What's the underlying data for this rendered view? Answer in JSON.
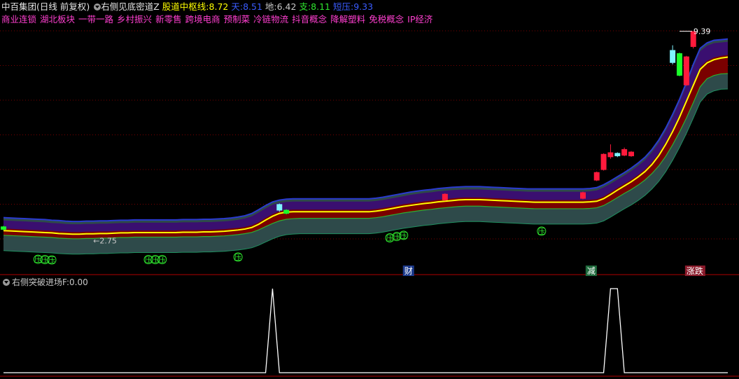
{
  "header": {
    "stock": "中百集团",
    "period": "(日线 前复权)",
    "indicator": "右侧见底密道Z",
    "pivot_label": "股道中枢线:",
    "pivot_value": "8.72",
    "sky_label": "天:",
    "sky_value": "8.51",
    "earth_label": "地:",
    "earth_value": "6.42",
    "support_label": "支:",
    "support_value": "8.11",
    "resist_label": "短压:",
    "resist_value": "9.33"
  },
  "concepts": [
    "商业连锁",
    "湖北板块",
    "一带一路",
    "乡村振兴",
    "新零售",
    "跨境电商",
    "预制菜",
    "冷链物流",
    "抖音概念",
    "降解塑料",
    "免税概念",
    "IP经济"
  ],
  "sub_indicator": {
    "name": "右侧突破进场F",
    "separator": ":",
    "value": "0.00"
  },
  "annotations": {
    "high": "9.39",
    "low": "2.75",
    "pressure": "压",
    "event_cai": "财",
    "event_jian": "减",
    "event_zhangdie": "涨跌"
  },
  "colors": {
    "band_outer": "#2e4a4a",
    "band_red": "#7a0000",
    "band_purple": "#3a0f70",
    "upper_line": "#2a3ad0",
    "middle_line": "#ffff00",
    "lower_line": "#2fae2f",
    "candle_up": "#ff1a3c",
    "candle_down": "#1aff2a",
    "candle_cyan": "#7ff4ff",
    "pressure_green": "#2ee62e",
    "signal_line": "#ffffff",
    "grid": "#7a0000"
  },
  "chart_data": {
    "type": "line",
    "x": [
      0,
      1,
      2,
      3,
      4,
      5,
      6,
      7,
      8,
      9,
      10,
      11,
      12,
      13,
      14,
      15,
      16,
      17,
      18,
      19,
      20,
      21,
      22,
      23,
      24,
      25,
      26,
      27,
      28,
      29,
      30,
      31,
      32,
      33,
      34,
      35,
      36,
      37,
      38,
      39,
      40,
      41,
      42,
      43,
      44,
      45,
      46,
      47,
      48,
      49,
      50,
      51,
      52,
      53,
      54,
      55,
      56,
      57,
      58,
      59,
      60,
      61,
      62,
      63,
      64,
      65,
      66,
      67,
      68,
      69,
      70,
      71,
      72,
      73,
      74,
      75,
      76,
      77,
      78,
      79,
      80,
      81,
      82,
      83,
      84,
      85,
      86,
      87,
      88,
      89,
      90,
      91,
      92,
      93,
      94,
      95,
      96,
      97,
      98,
      99,
      100,
      101,
      102,
      103,
      104,
      105
    ],
    "series": [
      {
        "values": [
          3.15,
          3.14,
          3.13,
          3.12,
          3.11,
          3.1,
          3.09,
          3.08,
          3.06,
          3.05,
          3.04,
          3.04,
          3.05,
          3.05,
          3.06,
          3.06,
          3.07,
          3.08,
          3.08,
          3.09,
          3.09,
          3.09,
          3.09,
          3.09,
          3.09,
          3.09,
          3.1,
          3.1,
          3.1,
          3.11,
          3.11,
          3.12,
          3.13,
          3.15,
          3.17,
          3.2,
          3.25,
          3.35,
          3.48,
          3.6,
          3.69,
          3.73,
          3.74,
          3.74,
          3.74,
          3.74,
          3.74,
          3.74,
          3.74,
          3.74,
          3.74,
          3.74,
          3.74,
          3.74,
          3.76,
          3.79,
          3.83,
          3.87,
          3.91,
          3.94,
          3.97,
          4.0,
          4.02,
          4.05,
          4.07,
          4.09,
          4.11,
          4.12,
          4.12,
          4.12,
          4.11,
          4.1,
          4.09,
          4.08,
          4.07,
          4.06,
          4.05,
          4.04,
          4.04,
          4.04,
          4.04,
          4.04,
          4.04,
          4.04,
          4.04,
          4.05,
          4.07,
          4.15,
          4.28,
          4.42,
          4.55,
          4.68,
          4.83,
          5.0,
          5.22,
          5.5,
          5.85,
          6.25,
          6.7,
          7.2,
          7.7,
          8.2,
          8.4,
          8.5,
          8.55,
          8.58
        ]
      },
      {
        "values": [
          3.25,
          3.24,
          3.23,
          3.22,
          3.21,
          3.2,
          3.19,
          3.17,
          3.16,
          3.14,
          3.13,
          3.13,
          3.14,
          3.14,
          3.15,
          3.15,
          3.16,
          3.17,
          3.17,
          3.18,
          3.18,
          3.18,
          3.18,
          3.18,
          3.18,
          3.18,
          3.19,
          3.19,
          3.19,
          3.2,
          3.2,
          3.21,
          3.22,
          3.24,
          3.27,
          3.31,
          3.38,
          3.5,
          3.63,
          3.74,
          3.8,
          3.83,
          3.84,
          3.84,
          3.84,
          3.84,
          3.84,
          3.84,
          3.84,
          3.84,
          3.84,
          3.84,
          3.84,
          3.84,
          3.86,
          3.89,
          3.93,
          3.97,
          4.01,
          4.05,
          4.08,
          4.11,
          4.13,
          4.16,
          4.18,
          4.2,
          4.21,
          4.22,
          4.22,
          4.22,
          4.21,
          4.2,
          4.19,
          4.18,
          4.17,
          4.16,
          4.15,
          4.15,
          4.15,
          4.15,
          4.15,
          4.15,
          4.15,
          4.15,
          4.15,
          4.16,
          4.19,
          4.28,
          4.4,
          4.53,
          4.66,
          4.8,
          4.96,
          5.14,
          5.38,
          5.68,
          6.05,
          6.48,
          6.95,
          7.48,
          8.05,
          8.55,
          8.72,
          8.8,
          8.82,
          8.84
        ]
      },
      {
        "values": [
          3.05,
          3.04,
          3.03,
          3.02,
          3.01,
          3.0,
          2.99,
          2.98,
          2.96,
          2.95,
          2.94,
          2.94,
          2.95,
          2.95,
          2.96,
          2.96,
          2.97,
          2.98,
          2.98,
          2.99,
          2.99,
          2.99,
          2.99,
          2.99,
          2.99,
          2.99,
          3.0,
          3.0,
          3.0,
          3.01,
          3.01,
          3.02,
          3.03,
          3.05,
          3.07,
          3.1,
          3.14,
          3.22,
          3.32,
          3.42,
          3.5,
          3.55,
          3.57,
          3.58,
          3.58,
          3.58,
          3.58,
          3.58,
          3.58,
          3.58,
          3.58,
          3.58,
          3.58,
          3.58,
          3.6,
          3.63,
          3.67,
          3.71,
          3.75,
          3.78,
          3.81,
          3.84,
          3.86,
          3.89,
          3.91,
          3.93,
          3.95,
          3.96,
          3.96,
          3.96,
          3.95,
          3.94,
          3.93,
          3.92,
          3.91,
          3.9,
          3.89,
          3.88,
          3.88,
          3.88,
          3.88,
          3.88,
          3.88,
          3.88,
          3.88,
          3.89,
          3.91,
          3.98,
          4.1,
          4.23,
          4.36,
          4.48,
          4.62,
          4.78,
          4.98,
          5.22,
          5.52,
          5.88,
          6.28,
          6.72,
          7.2,
          7.7,
          7.95,
          8.05,
          8.1,
          8.11
        ]
      }
    ],
    "ylim": [
      2.3,
      9.6
    ],
    "candles": [
      {
        "x": 0,
        "o": 3.18,
        "c": 3.28,
        "h": 3.3,
        "l": 3.16,
        "dir": "down"
      },
      {
        "x": 40,
        "o": 3.78,
        "c": 3.98,
        "h": 4.0,
        "l": 3.74,
        "dir": "cyan"
      },
      {
        "x": 41,
        "o": 3.68,
        "c": 3.8,
        "h": 3.82,
        "l": 3.66,
        "dir": "down"
      },
      {
        "x": 64,
        "o": 4.1,
        "c": 4.3,
        "h": 4.32,
        "l": 4.08,
        "dir": "up"
      },
      {
        "x": 84,
        "o": 4.15,
        "c": 4.35,
        "h": 4.37,
        "l": 4.13,
        "dir": "up"
      },
      {
        "x": 86,
        "o": 4.72,
        "c": 4.98,
        "h": 5.0,
        "l": 4.7,
        "dir": "up"
      },
      {
        "x": 87,
        "o": 5.05,
        "c": 5.55,
        "h": 5.57,
        "l": 5.03,
        "dir": "up"
      },
      {
        "x": 88,
        "o": 5.45,
        "c": 5.6,
        "h": 5.85,
        "l": 5.4,
        "dir": "up"
      },
      {
        "x": 89,
        "o": 5.48,
        "c": 5.58,
        "h": 5.6,
        "l": 5.45,
        "dir": "cyan"
      },
      {
        "x": 90,
        "o": 5.5,
        "c": 5.7,
        "h": 5.75,
        "l": 5.48,
        "dir": "up"
      },
      {
        "x": 91,
        "o": 5.48,
        "c": 5.62,
        "h": 5.64,
        "l": 5.46,
        "dir": "up"
      },
      {
        "x": 97,
        "o": 8.4,
        "c": 8.8,
        "h": 8.95,
        "l": 8.35,
        "dir": "cyan"
      },
      {
        "x": 98,
        "o": 8.0,
        "c": 8.7,
        "h": 8.72,
        "l": 7.98,
        "dir": "down"
      },
      {
        "x": 99,
        "o": 7.7,
        "c": 8.6,
        "h": 8.62,
        "l": 7.68,
        "dir": "up"
      },
      {
        "x": 100,
        "o": 8.9,
        "c": 9.39,
        "h": 9.39,
        "l": 8.85,
        "dir": "up"
      }
    ],
    "signal": {
      "ylim": [
        0,
        1
      ],
      "pulses": [
        [
          38,
          39,
          40
        ],
        [
          87,
          88,
          89,
          90
        ]
      ]
    }
  }
}
